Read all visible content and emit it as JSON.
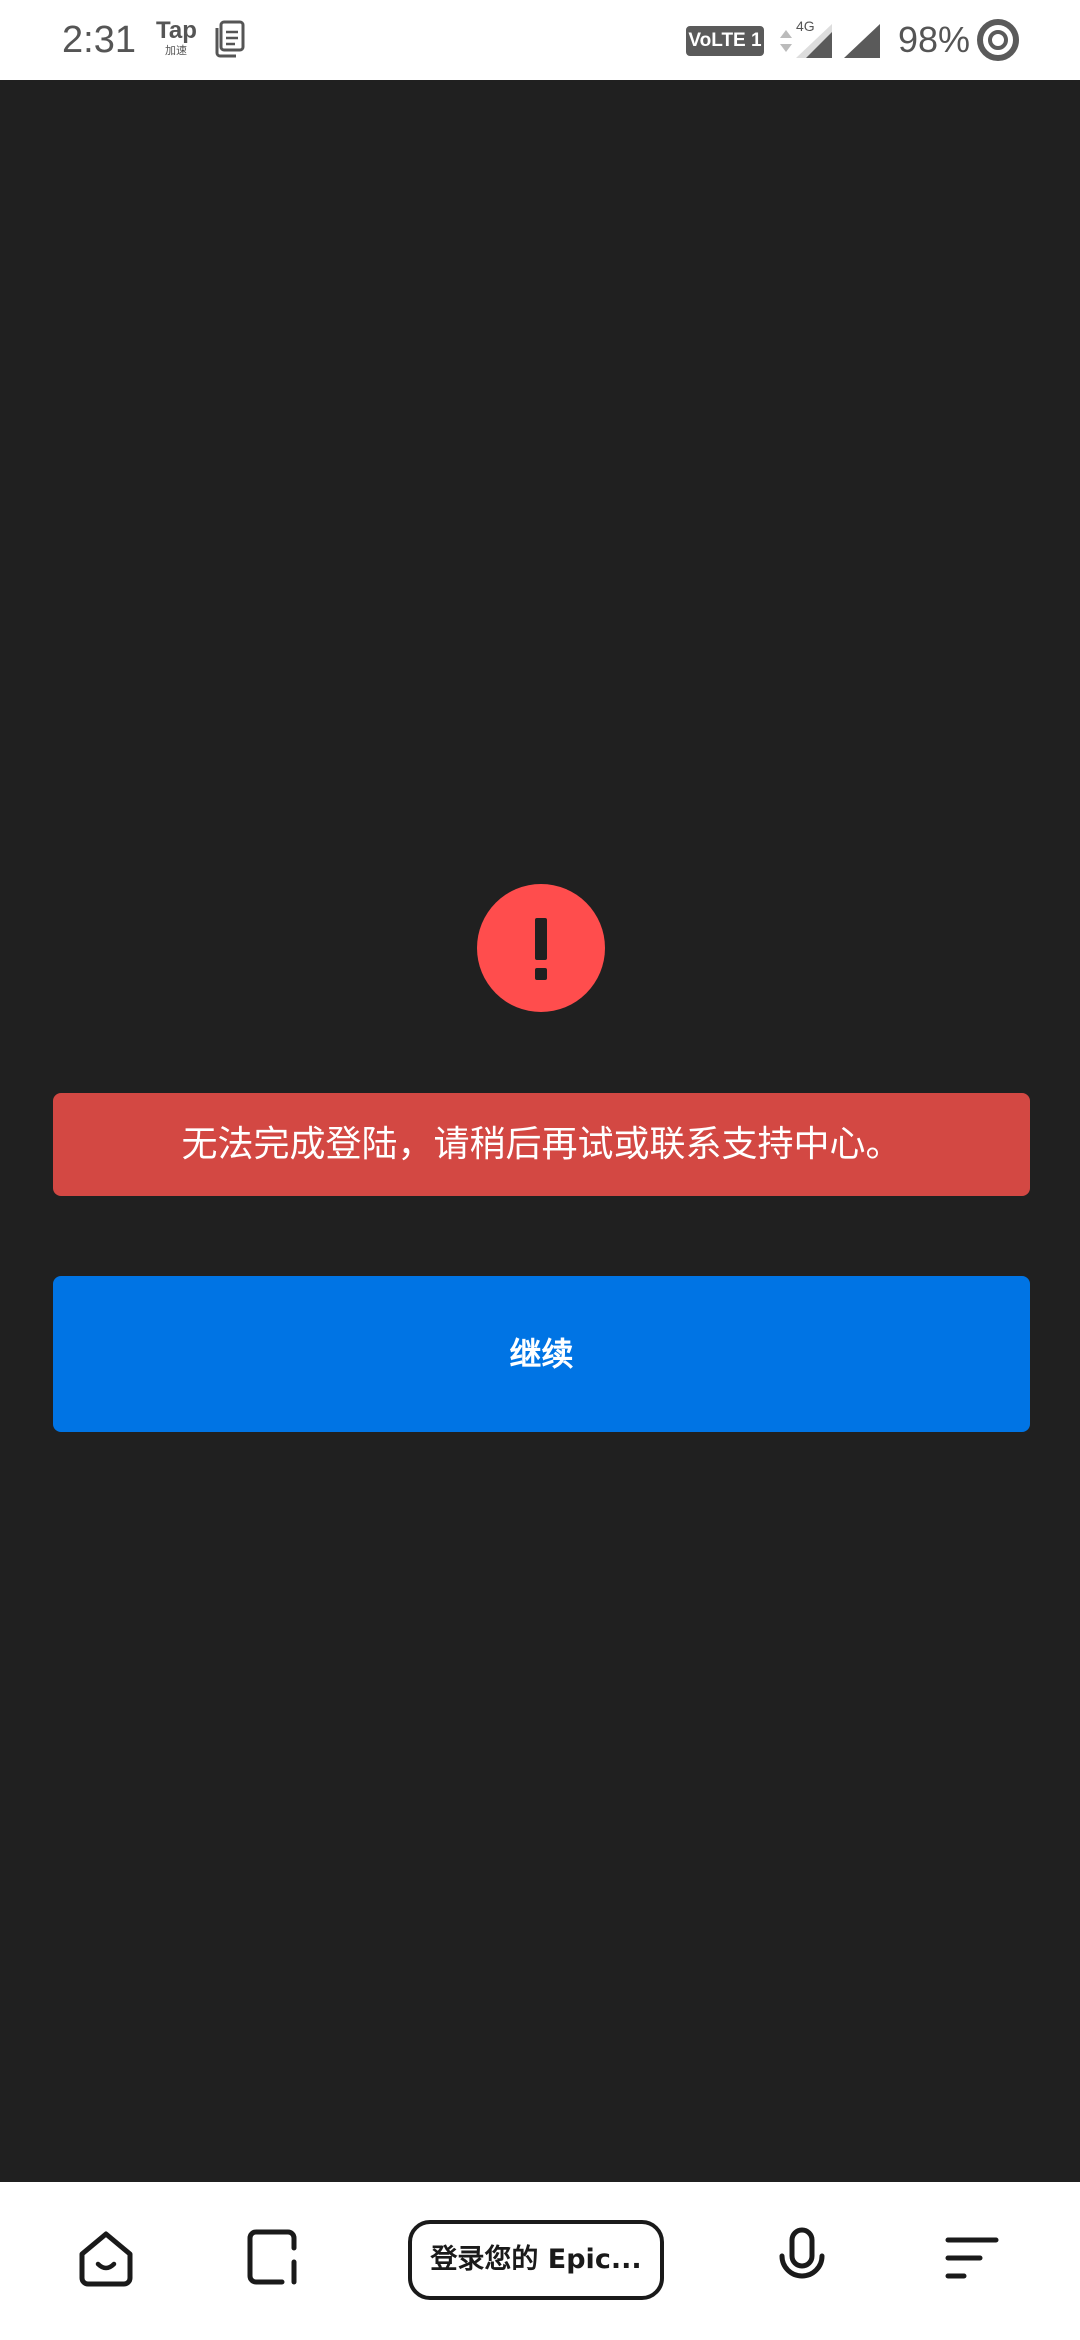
{
  "status_bar": {
    "time": "2:31",
    "tap_label": "Tap",
    "tap_sublabel": "加速",
    "volte_label": "VoLTE 1",
    "network_type": "4G",
    "battery_percent": "98%",
    "icons": [
      "tap-accelerator-icon",
      "clipboard-icon",
      "data-arrows-icon",
      "signal-icon",
      "battery-ring-icon"
    ]
  },
  "main": {
    "alert_icon": "exclamation-icon",
    "error_message": "无法完成登陆，请稍后再试或联系支持中心。",
    "continue_label": "继续"
  },
  "bottom_bar": {
    "address_text": "登录您的 Epic...",
    "icons": [
      "home-icon",
      "tabs-icon",
      "microphone-icon",
      "menu-icon"
    ]
  },
  "colors": {
    "background": "#202020",
    "alert_red": "#ff4d4d",
    "error_banner": "#d34843",
    "button_blue": "#0074e4",
    "bar_white": "#ffffff"
  }
}
